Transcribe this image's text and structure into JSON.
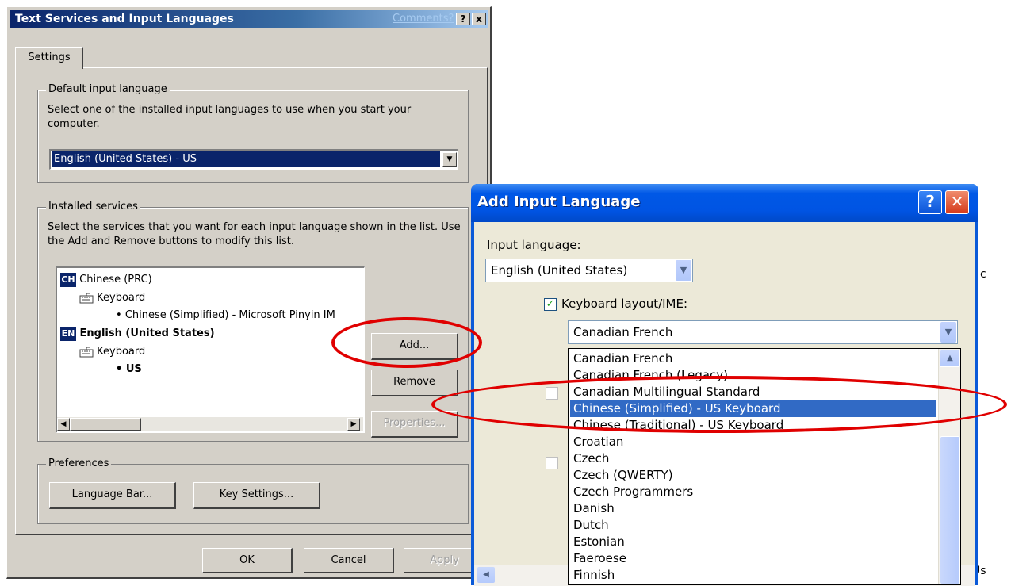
{
  "classic_dialog": {
    "title": "Text Services and Input Languages",
    "comments_link": "Comments?",
    "help_glyph": "?",
    "close_glyph": "x",
    "tab_label": "Settings",
    "default_lang": {
      "group_label": "Default input language",
      "description": "Select one of the installed input languages to use when you start your computer.",
      "selected_value": "English (United States) - US"
    },
    "installed": {
      "group_label": "Installed services",
      "description": "Select the services that you want for each input language shown in the list. Use the Add and Remove buttons to modify this list.",
      "tree": [
        {
          "code": "CH",
          "language": "Chinese (PRC)",
          "category": "Keyboard",
          "layout": "Chinese (Simplified) - Microsoft Pinyin IM"
        },
        {
          "code": "EN",
          "language": "English (United States)",
          "category": "Keyboard",
          "layout": "US"
        }
      ],
      "bullet": "•",
      "add_label": "Add...",
      "remove_label": "Remove",
      "properties_label": "Properties..."
    },
    "preferences": {
      "group_label": "Preferences",
      "language_bar_label": "Language Bar...",
      "key_settings_label": "Key Settings..."
    },
    "footer": {
      "ok": "OK",
      "cancel": "Cancel",
      "apply": "Apply"
    }
  },
  "xp_dialog": {
    "title": "Add Input Language",
    "help_glyph": "?",
    "close_glyph": "✕",
    "input_language_label": "Input language:",
    "input_language_value": "English (United States)",
    "keyboard_checkbox_label": "Keyboard layout/IME:",
    "keyboard_checked": true,
    "keyboard_value": "Canadian French",
    "dropdown_options": [
      "Canadian French",
      "Canadian French (Legacy)",
      "Canadian Multilingual Standard",
      "Chinese (Simplified) - US Keyboard",
      "Chinese (Traditional) - US Keyboard",
      "Croatian",
      "Czech",
      "Czech (QWERTY)",
      "Czech Programmers",
      "Danish",
      "Dutch",
      "Estonian",
      "Faeroese",
      "Finnish"
    ],
    "selected_option": "Chinese (Simplified) - US Keyboard"
  },
  "background": {
    "fragment_c": "c",
    "fragment_us": "Us"
  },
  "colors": {
    "annotation": "#e00000",
    "xp_titlebar": "#0054e3",
    "selection": "#316ac5",
    "classic_face": "#d4d0c8"
  }
}
